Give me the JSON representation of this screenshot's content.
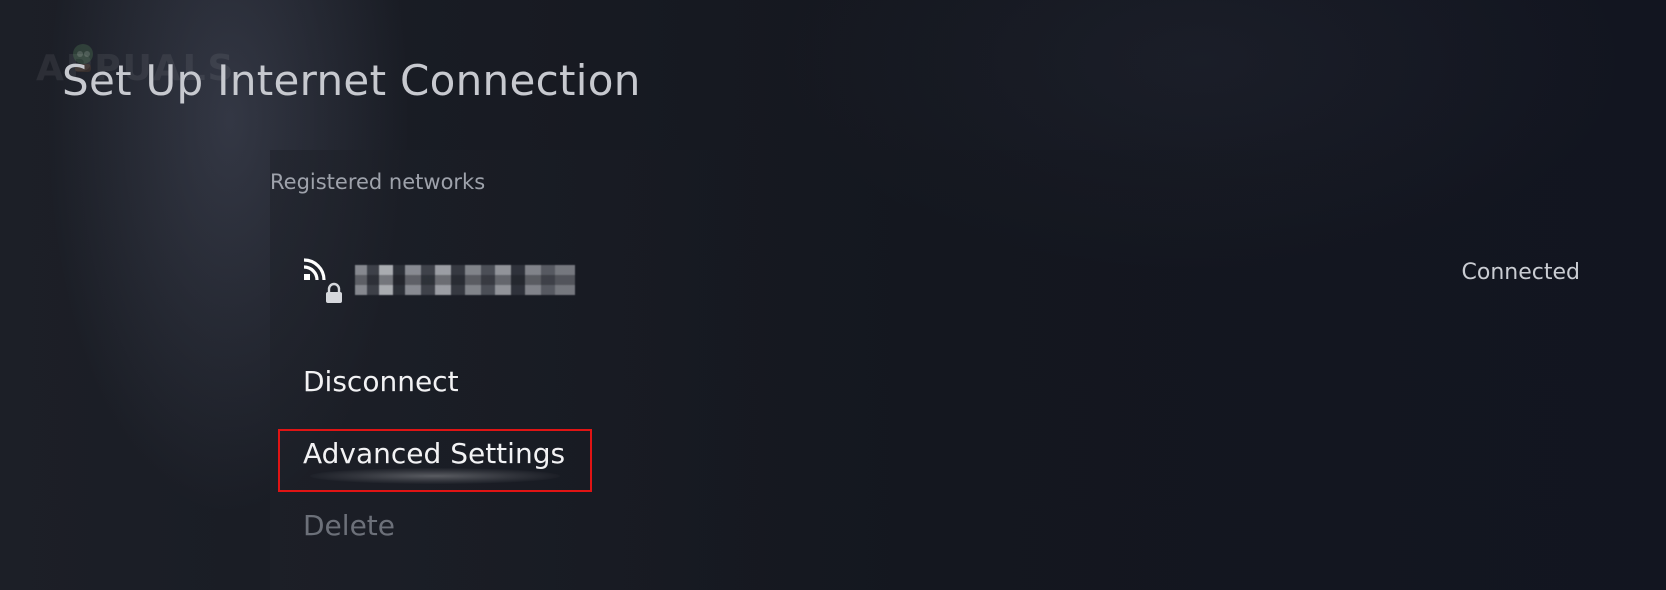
{
  "watermark": {
    "text": "APPUALS"
  },
  "header": {
    "title": "Set Up Internet Connection"
  },
  "section": {
    "label": "Registered networks"
  },
  "network": {
    "name": "",
    "status": "Connected",
    "icons": [
      "wifi-icon",
      "lock-icon"
    ]
  },
  "menu": {
    "items": [
      {
        "label": "Disconnect",
        "enabled": true
      },
      {
        "label": "Advanced Settings",
        "enabled": true,
        "focused": true
      },
      {
        "label": "Delete",
        "enabled": false
      }
    ]
  },
  "colors": {
    "highlight": "#e01414",
    "text_primary": "#f2f2f4",
    "text_disabled": "#6c7079",
    "text_secondary": "#9ea2ab"
  }
}
